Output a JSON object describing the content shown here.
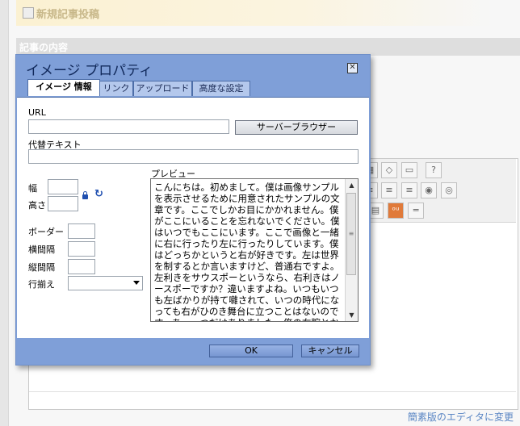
{
  "page": {
    "title": "新規記事投稿",
    "section_label": "記事の内容",
    "simple_editor_link": "簡素版のエディタに変更"
  },
  "dialog": {
    "title": "イメージ プロパティ",
    "close_glyph": "✕",
    "tabs": [
      {
        "label": "イメージ 情報",
        "active": true
      },
      {
        "label": "リンク",
        "active": false
      },
      {
        "label": "アップロード",
        "active": false
      },
      {
        "label": "高度な設定",
        "active": false
      }
    ],
    "url_label": "URL",
    "url_value": "",
    "browse_server_button": "サーバーブラウザー",
    "alt_label": "代替テキスト",
    "alt_value": "",
    "width_label": "幅",
    "height_label": "高さ",
    "border_label": "ボーダー",
    "hspace_label": "横間隔",
    "vspace_label": "縦間隔",
    "align_label": "行揃え",
    "align_value": "",
    "preview_label": "プレビュー",
    "preview_text": "こんにちは。初めまして。僕は画像サンプルを表示させるために用意されたサンプルの文章です。ここでしかお目にかかれません。僕がここにいることを忘れないでください。僕はいつでもここにいます。ここで画像と一緒に右に行ったり左に行ったりしています。僕はどっちかというと右が好きです。左は世界を制するとか言いますけど、普通右ですよ。左利きをサウスポーというなら、右利きはノースポーですか？違いますよね。いつもいつも左ばかりが持て囃されて、いつの時代になっても右がひのき舞台に立つことはないのです。あ、一つだけありました。俺の右腕とかって言います",
    "ok_button": "OK",
    "cancel_button": "キャンセル"
  },
  "colors": {
    "dialog_frame": "#7f9fd8",
    "title_text": "#10285a",
    "link": "#5a86c4"
  },
  "icons": {
    "lock": "lock-icon",
    "reset_size": "reset-size-icon",
    "close": "close-icon"
  }
}
